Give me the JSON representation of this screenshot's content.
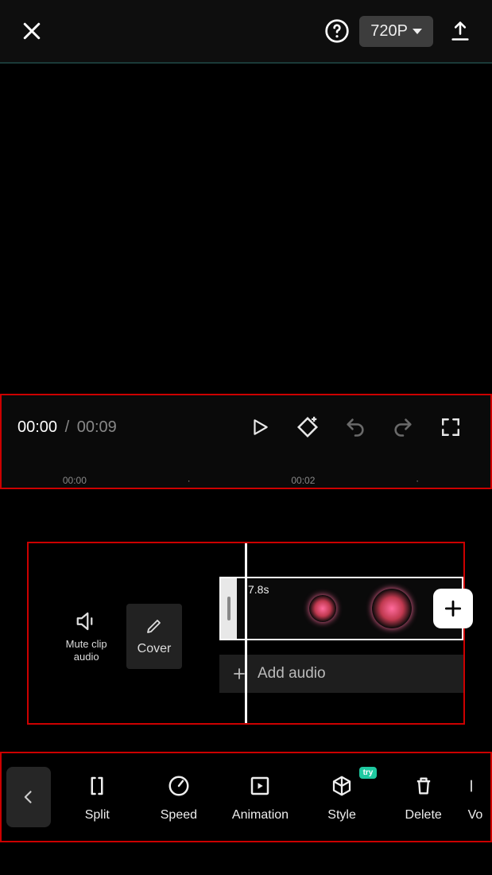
{
  "header": {
    "resolution": "720P"
  },
  "playback": {
    "current": "00:00",
    "separator": "/",
    "total": "00:09",
    "tick1": "00:00",
    "tick2": "00:02"
  },
  "timeline": {
    "mute_label_l1": "Mute clip",
    "mute_label_l2": "audio",
    "cover_label": "Cover",
    "clip_duration": "7.8s",
    "add_audio_label": "Add audio"
  },
  "toolbar": {
    "split": "Split",
    "speed": "Speed",
    "animation": "Animation",
    "style": "Style",
    "delete": "Delete",
    "volume": "Vo",
    "try_badge": "try"
  }
}
